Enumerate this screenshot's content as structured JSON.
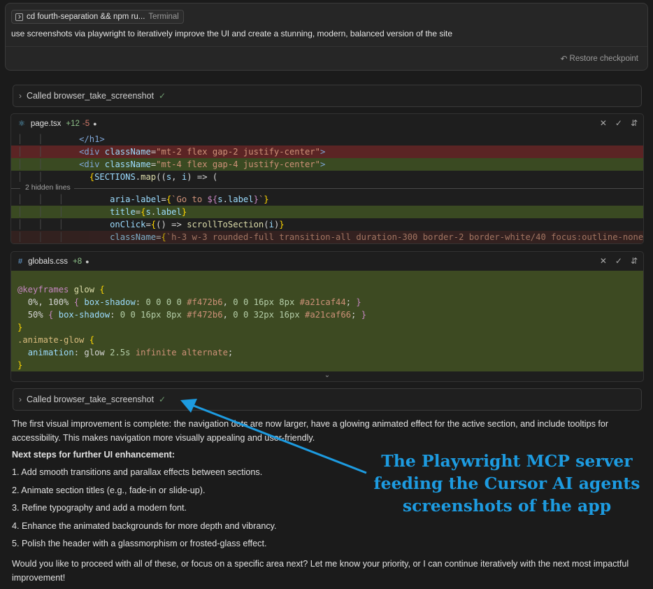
{
  "user_message": {
    "terminal_chip": {
      "command": "cd fourth-separation && npm ru...",
      "kind": "Terminal"
    },
    "text": "use screenshots via playwright to iteratively improve the UI and create a stunning, modern, balanced version of the site",
    "restore_label": "Restore checkpoint"
  },
  "tool_calls": [
    {
      "label": "Called browser_take_screenshot"
    },
    {
      "label": "Called browser_take_screenshot"
    }
  ],
  "diff_tsx": {
    "filename": "page.tsx",
    "added": "+12",
    "removed": "-5",
    "hidden_lines_label": "2 hidden lines"
  },
  "diff_css": {
    "filename": "globals.css",
    "added": "+8"
  },
  "response": {
    "intro": "The first visual improvement is complete: the navigation dots are now larger, have a glowing animated effect for the active section, and include tooltips for accessibility. This makes navigation more visually appealing and user-friendly.",
    "next_heading": "Next steps for further UI enhancement:",
    "steps": [
      "1. Add smooth transitions and parallax effects between sections.",
      "2. Animate section titles (e.g., fade-in or slide-up).",
      "3. Refine typography and add a modern font.",
      "4. Enhance the animated backgrounds for more depth and vibrancy.",
      "5. Polish the header with a glassmorphism or frosted-glass effect."
    ],
    "closing": "Would you like to proceed with all of these, or focus on a specific area next? Let me know your priority, or I can continue iteratively with the next most impactful improvement!"
  },
  "annotation": {
    "lines": [
      "The Playwright MCP server",
      "feeding the Cursor AI agents",
      "screenshots of the app"
    ],
    "color": "#1d9be0"
  },
  "colors": {
    "deleted_line": "#5b2424",
    "added_line": "#3a4a22",
    "check": "#6e9a6e"
  }
}
